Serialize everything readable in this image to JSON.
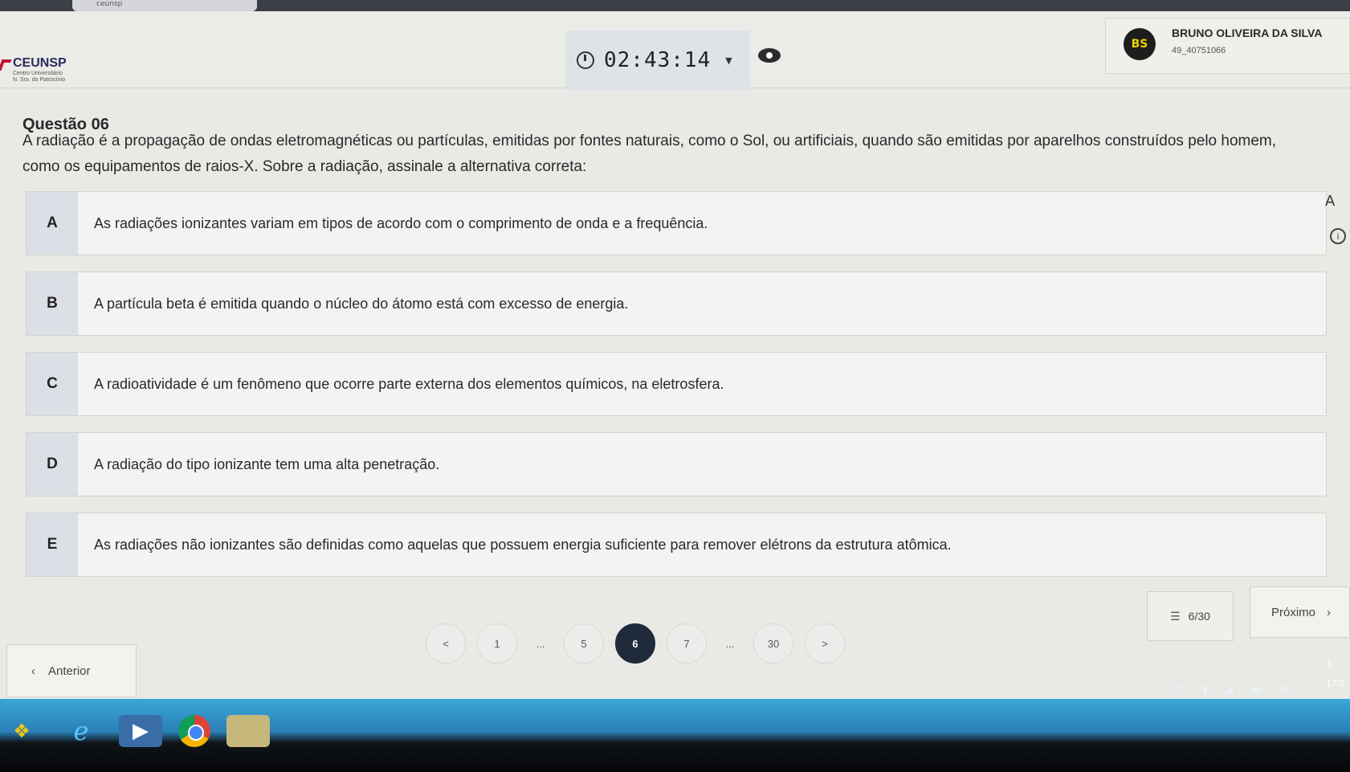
{
  "browser": {
    "tab_title": "ceunsp"
  },
  "header": {
    "logo": {
      "name": "CEUNSP",
      "subtitle_line1": "Centro Universitário",
      "subtitle_line2": "N. Sra. do Patrocínio"
    },
    "timer": {
      "value": "02:43:14"
    },
    "user": {
      "initials": "BS",
      "name": "BRUNO OLIVEIRA DA SILVA",
      "id": "49_40751066"
    }
  },
  "question": {
    "title": "Questão 06",
    "text": "A radiação é a propagação de ondas eletromagnéticas ou partículas, emitidas por fontes naturais, como o Sol, ou artificiais, quando são emitidas por aparelhos construídos pelo homem, como os equipamentos de raios-X. Sobre a radiação, assinale a alternativa correta:",
    "options": [
      {
        "letter": "A",
        "text": "As radiações ionizantes variam em tipos de acordo com o comprimento de onda e a frequência."
      },
      {
        "letter": "B",
        "text": "A partícula beta é emitida quando o núcleo do átomo está com excesso de energia."
      },
      {
        "letter": "C",
        "text": "A radioatividade é um fenômeno que ocorre parte externa dos elementos químicos, na eletrosfera."
      },
      {
        "letter": "D",
        "text": "A radiação do tipo ionizante tem uma alta penetração."
      },
      {
        "letter": "E",
        "text": "As radiações não ionizantes são definidas como aquelas que possuem energia suficiente para remover elétrons da estrutura atômica."
      }
    ]
  },
  "side_tools": {
    "font_label": "A",
    "info_label": "i"
  },
  "navigation": {
    "prev_label": "Anterior",
    "next_label": "Próximo",
    "counter": "6/30",
    "pages": [
      {
        "label": "<",
        "kind": "arrow"
      },
      {
        "label": "1",
        "kind": "page"
      },
      {
        "label": "...",
        "kind": "ellipsis"
      },
      {
        "label": "5",
        "kind": "page"
      },
      {
        "label": "6",
        "kind": "active"
      },
      {
        "label": "7",
        "kind": "page"
      },
      {
        "label": "...",
        "kind": "ellipsis"
      },
      {
        "label": "30",
        "kind": "page"
      },
      {
        "label": ">",
        "kind": "arrow"
      }
    ]
  },
  "taskbar": {
    "lang": "PT",
    "time": "1",
    "date": "17/0",
    "apps": [
      "windows-start-icon",
      "internet-explorer-icon",
      "media-player-icon",
      "chrome-icon",
      "folder-app-icon"
    ]
  }
}
